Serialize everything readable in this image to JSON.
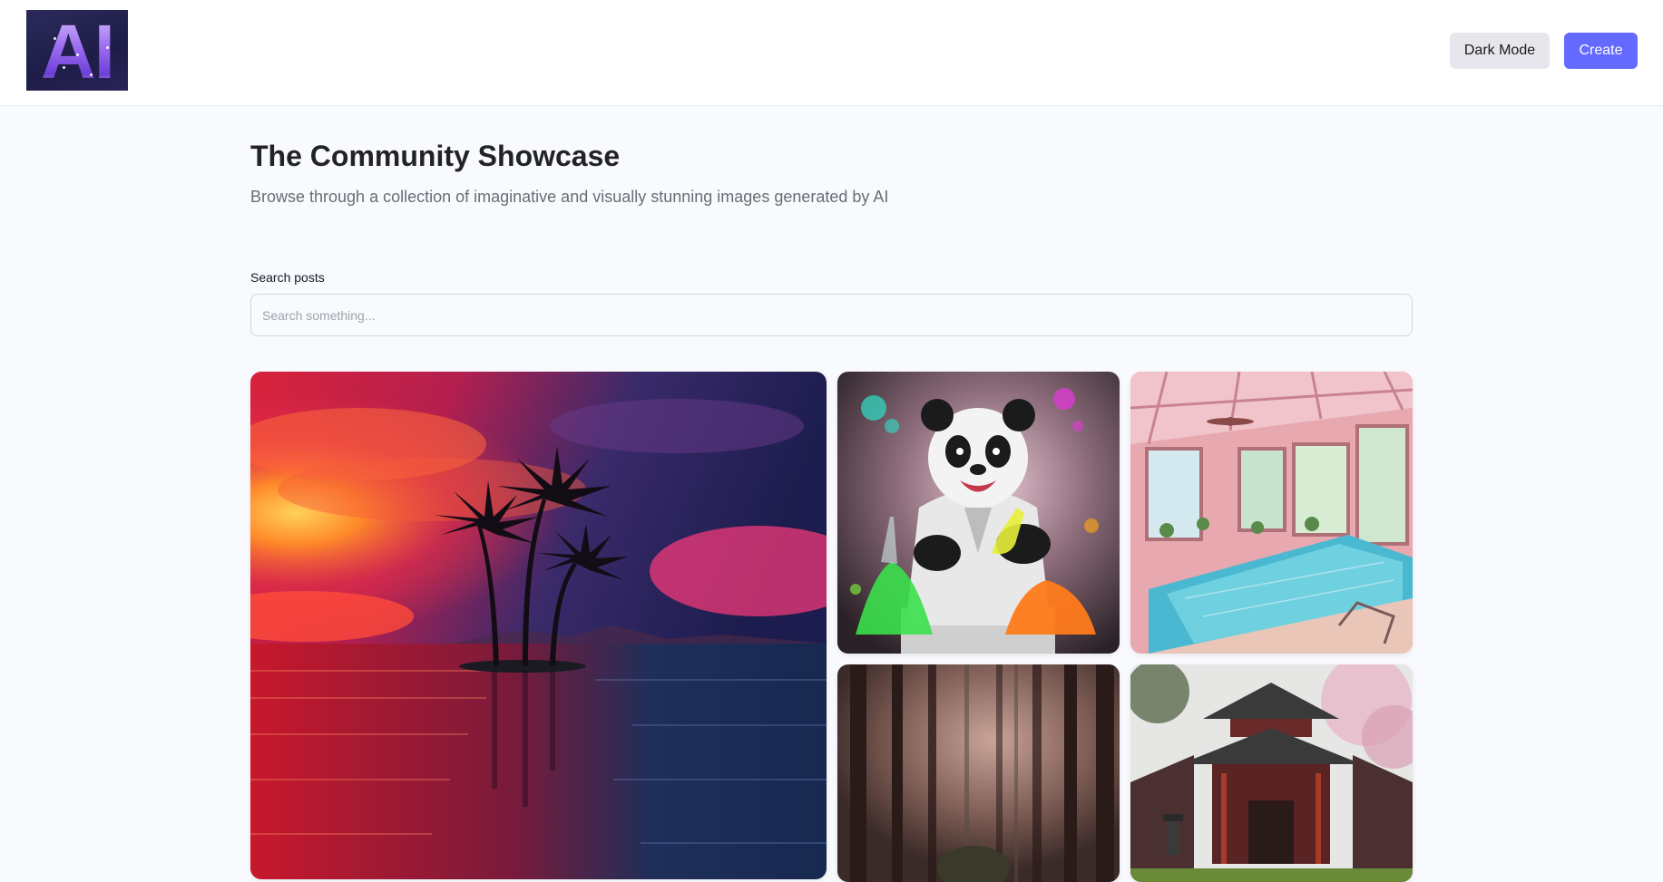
{
  "header": {
    "logo_text": "AI",
    "dark_mode_label": "Dark Mode",
    "create_label": "Create",
    "accent_color": "#6469ff"
  },
  "main": {
    "title": "The Community Showcase",
    "subtitle": "Browse through a collection of imaginative and visually stunning images generated by AI"
  },
  "search": {
    "label": "Search posts",
    "placeholder": "Search something...",
    "value": ""
  },
  "gallery": {
    "cards": [
      {
        "subject": "tropical sunset over ocean with palm trees"
      },
      {
        "subject": "panda scientist with colorful chemistry flasks"
      },
      {
        "subject": "pink indoor swimming pool sunroom"
      },
      {
        "subject": "misty dark forest"
      },
      {
        "subject": "japanese temple with cherry blossoms"
      }
    ]
  }
}
